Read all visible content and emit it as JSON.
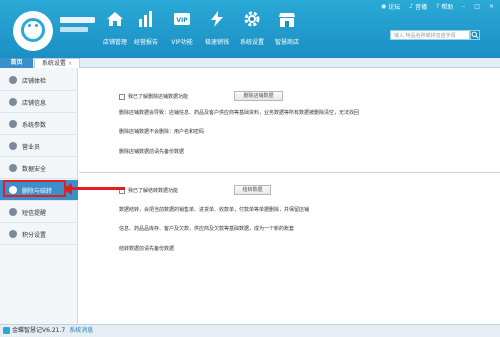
{
  "header": {
    "nav": [
      {
        "label": "店铺管理",
        "icon": "home-icon"
      },
      {
        "label": "经营报告",
        "icon": "bar-chart-icon"
      },
      {
        "label": "VIP功能",
        "icon": "vip-card-icon"
      },
      {
        "label": "极速销钱",
        "icon": "lightning-icon"
      },
      {
        "label": "系统设置",
        "icon": "gear-icon"
      },
      {
        "label": "智慧商店",
        "icon": "store-icon"
      }
    ],
    "top_links": {
      "forum": "论坛",
      "sound": "音播",
      "help": "帮助"
    },
    "search_placeholder": "输入 特品名称或拼音首字母"
  },
  "tabs": {
    "home": "首页",
    "settings": "系统设置",
    "close": "×"
  },
  "sidebar": {
    "items": [
      {
        "label": "店铺体检",
        "icon": "check-icon"
      },
      {
        "label": "店铺信息",
        "icon": "info-icon"
      },
      {
        "label": "系统参数",
        "icon": "gear-icon"
      },
      {
        "label": "营业员",
        "icon": "user-icon"
      },
      {
        "label": "数据安全",
        "icon": "shield-icon"
      },
      {
        "label": "删除与结转",
        "icon": "delete-icon"
      },
      {
        "label": "短信提醒",
        "icon": "sms-icon"
      },
      {
        "label": "积分设置",
        "icon": "points-icon"
      }
    ]
  },
  "main": {
    "delete_section": {
      "checkbox_label": "我已了解删除店铺数据功能",
      "button": "删除店铺数据",
      "desc1": "删除店铺数据会导致：店铺信息、药品及客户供应商等基础资料，业务数据等所有数据被删除清空，无法找回",
      "desc2": "删除店铺数据不会删除：用户名和密码",
      "desc3": "删除店铺数据前请先备份数据"
    },
    "carry_section": {
      "checkbox_label": "我已了解结转数据功能",
      "button": "结转数据",
      "desc1": "数据结转，会把当前数据的销售单、进货单、收款单，付款单等单据删除，并保留店铺",
      "desc2": "信息、药品品库存、客户及欠款，供应商及欠款等基础数据，成为一个新的账套",
      "desc3": "结转数据前请先备份数据"
    }
  },
  "statusbar": {
    "app": "金蝶智慧记V6.21.7",
    "message": "系统消息"
  },
  "colors": {
    "brand": "#2aa9d6",
    "active": "#3c8fc8",
    "highlight": "#e02020"
  }
}
